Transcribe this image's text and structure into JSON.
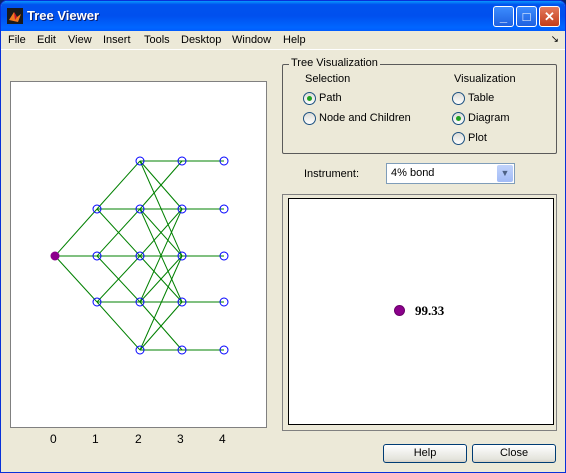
{
  "window": {
    "title": "Tree Viewer"
  },
  "titlebar_buttons": {
    "minimize": "_",
    "maximize": "□",
    "close": "✕"
  },
  "menu": [
    "File",
    "Edit",
    "View",
    "Insert",
    "Tools",
    "Desktop",
    "Window",
    "Help"
  ],
  "menu_dock_icon": "dock-arrow-icon",
  "tree_plot": {
    "x_ticks": [
      "0",
      "1",
      "2",
      "3",
      "4"
    ],
    "root_color": "#8b008b",
    "node_color": "#0000ff",
    "edge_color": "#008000"
  },
  "tree_visualization": {
    "legend": "Tree Visualization",
    "selection": {
      "label": "Selection",
      "options": [
        "Path",
        "Node and Children"
      ],
      "selected": "Path"
    },
    "visualization": {
      "label": "Visualization",
      "options": [
        "Table",
        "Diagram",
        "Plot"
      ],
      "selected": "Diagram"
    }
  },
  "instrument": {
    "label": "Instrument:",
    "value": "4% bond"
  },
  "node_value": {
    "text": "99.33",
    "color": "#8b008b"
  },
  "buttons": {
    "help": "Help",
    "close": "Close"
  }
}
